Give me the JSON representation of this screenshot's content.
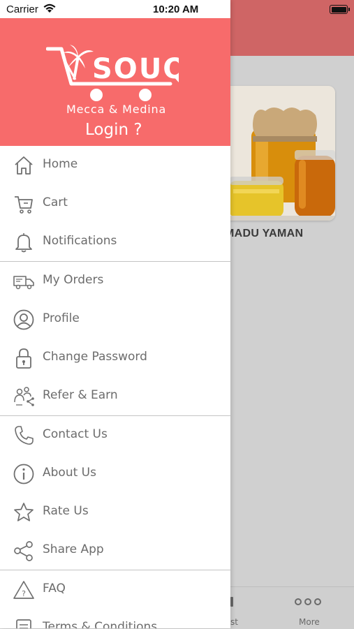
{
  "status_bar": {
    "carrier": "Carrier",
    "time": "10:20 AM"
  },
  "drawer": {
    "brand": "SOUQ",
    "subtitle": "Mecca & Medina",
    "login": "Login ?",
    "groups": [
      [
        {
          "label": "Home",
          "icon": "home-icon"
        },
        {
          "label": "Cart",
          "icon": "cart-icon"
        },
        {
          "label": "Notifications",
          "icon": "bell-icon"
        }
      ],
      [
        {
          "label": "My Orders",
          "icon": "truck-icon"
        },
        {
          "label": "Profile",
          "icon": "user-icon"
        },
        {
          "label": "Change Password",
          "icon": "lock-icon"
        },
        {
          "label": "Refer & Earn",
          "icon": "refer-icon"
        }
      ],
      [
        {
          "label": "Contact Us",
          "icon": "phone-icon"
        },
        {
          "label": "About Us",
          "icon": "info-icon"
        },
        {
          "label": "Rate Us",
          "icon": "star-icon"
        },
        {
          "label": "Share App",
          "icon": "share-icon"
        }
      ],
      [
        {
          "label": "FAQ",
          "icon": "faq-icon"
        },
        {
          "label": "Terms & Conditions",
          "icon": "document-icon"
        }
      ]
    ]
  },
  "background": {
    "product_name": "MADU YAMAN",
    "tabs": {
      "partial_label": "st",
      "more_label": "More"
    }
  },
  "colors": {
    "header": "#f76b6b",
    "menu_text": "#6c6c6c",
    "icon": "#6f6f6f"
  }
}
